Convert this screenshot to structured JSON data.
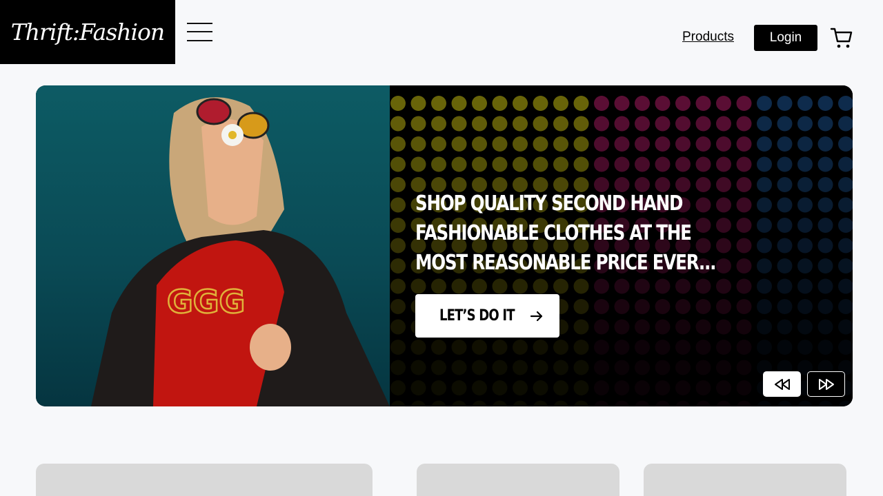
{
  "header": {
    "logo_text": "Thrift:Fashion",
    "nav_products": "Products",
    "login_label": "Login"
  },
  "hero": {
    "heading": "Shop quality second hand fashionable clothes at the most reasonable price ever...",
    "cta_label": "LET’S DO IT"
  },
  "colors": {
    "brand": "#000000",
    "background": "#f7f8fa",
    "card_placeholder": "#d9d9d9"
  },
  "icons": [
    "menu-icon",
    "cart-icon",
    "arrow-right-icon",
    "rewind-icon",
    "fast-forward-icon"
  ]
}
